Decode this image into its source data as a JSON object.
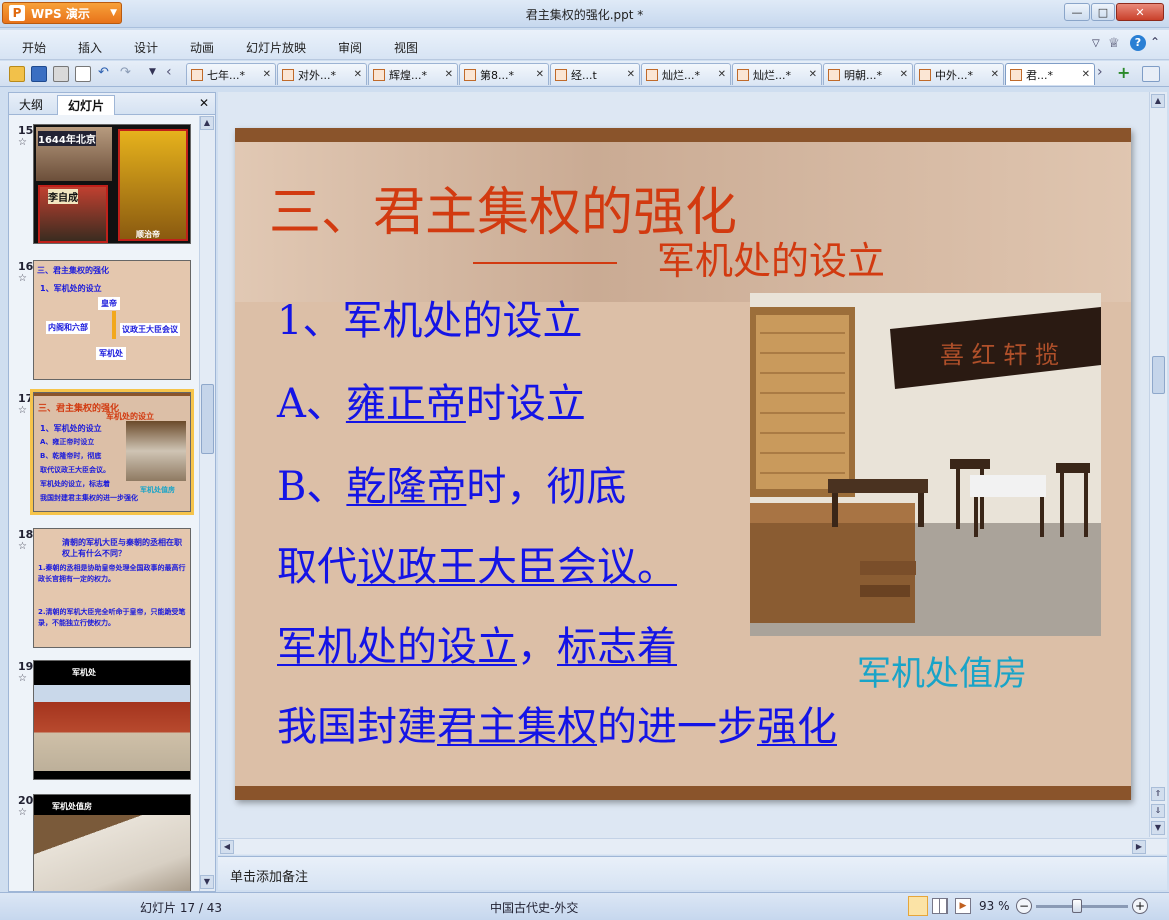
{
  "window": {
    "app_name": "WPS 演示",
    "title": "君主集权的强化.ppt *",
    "minimize": "—",
    "maximize": "□",
    "close": "✕"
  },
  "menu": [
    "开始",
    "插入",
    "设计",
    "动画",
    "幻灯片放映",
    "审阅",
    "视图"
  ],
  "doc_tabs": [
    {
      "label": "七年...*"
    },
    {
      "label": "对外...*"
    },
    {
      "label": "辉煌...*"
    },
    {
      "label": "第8...*"
    },
    {
      "label": "经...t"
    },
    {
      "label": "灿烂...*"
    },
    {
      "label": "灿烂...*"
    },
    {
      "label": "明朝...*"
    },
    {
      "label": "中外...*"
    },
    {
      "label": "君...*"
    }
  ],
  "left_pane": {
    "tab_outline": "大纲",
    "tab_slides": "幻灯片",
    "close": "✕",
    "thumbs": [
      {
        "num": "15",
        "star": "☆",
        "lines": [
          "1644年北京",
          "李自成",
          "顺治帝"
        ]
      },
      {
        "num": "16",
        "star": "☆",
        "lines": [
          "三、君主集权的强化",
          "1、军机处的设立",
          "皇帝",
          "内阁和六部",
          "议政王大臣会议",
          "军机处"
        ]
      },
      {
        "num": "17",
        "star": "☆",
        "lines": [
          "三、君主集权的强化",
          "军机处的设立",
          "1、军机处的设立",
          "A、雍正帝时设立",
          "B、乾隆帝时，彻底",
          "取代议政王大臣会议。",
          "军机处的设立，标志着",
          "我国封建君主集权的进一步强化",
          "军机处值房"
        ]
      },
      {
        "num": "18",
        "star": "☆",
        "lines": [
          "清朝的军机大臣与秦朝的丞相在职权上有什么不同？",
          "1.秦朝的丞相是协助皇帝处理全国政事的最高行政长官拥有一定的权力。",
          "2.清朝的军机大臣完全听命于皇帝，只能跪受笔录，不能独立行使权力。"
        ]
      },
      {
        "num": "19",
        "star": "☆",
        "lines": [
          "军机处"
        ]
      },
      {
        "num": "20",
        "star": "☆",
        "lines": [
          "军机处值房"
        ]
      }
    ]
  },
  "slide": {
    "title": "三、君主集权的强化",
    "subtitle": "军机处的设立",
    "line1": "1、军机处的设立",
    "line2_prefix": "A、",
    "line2_u": "雍正帝",
    "line2_suffix": "时设立",
    "line3_prefix": "B、",
    "line3_u": "乾隆帝",
    "line3_suffix": "时，彻底",
    "line4_prefix": "取代",
    "line4_u": "议政王大臣会议。",
    "line5_u1": "军机处的设立",
    "line5_mid": "，",
    "line5_u2": "标志着",
    "line6_a": "我国封建",
    "line6_u1": "君主集权",
    "line6_b": "的进一步",
    "line6_u2": "强化",
    "photo_sign": "喜 红 轩 揽",
    "caption": "军机处值房"
  },
  "notes_placeholder": "单击添加备注",
  "status": {
    "slide_counter": "幻灯片 17 / 43",
    "template": "中国古代史-外交",
    "zoom": "93 %"
  }
}
